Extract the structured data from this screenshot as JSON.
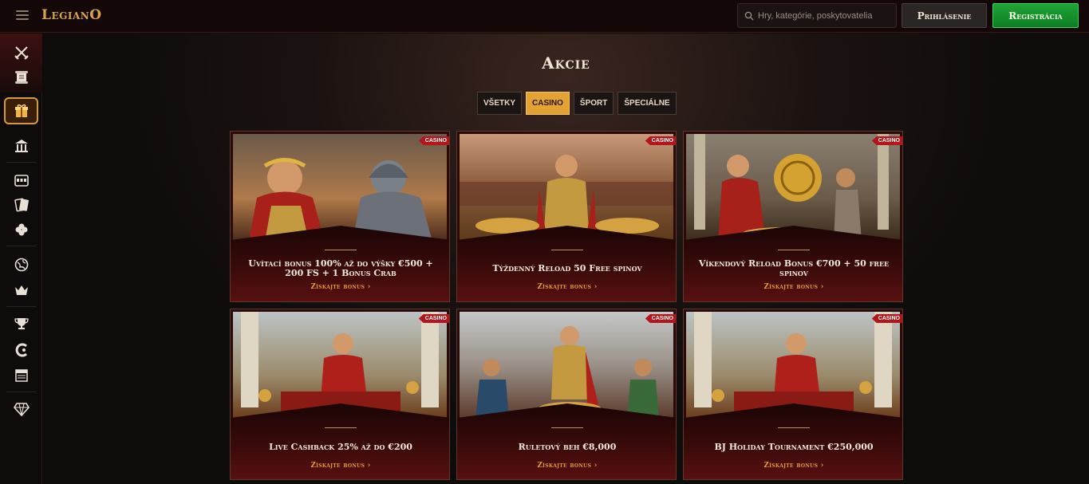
{
  "header": {
    "logo": "LegianO",
    "search_placeholder": "Hry, kategórie, poskytovatelia",
    "login_label": "Prihlásenie",
    "register_label": "Registrácia"
  },
  "sidebar": {
    "icons": [
      "crossed-swords-icon",
      "scroll-icon",
      "gift-chest-icon",
      "temple-icon",
      "slot-machine-icon",
      "cards-icon",
      "clover-icon",
      "globe-icon",
      "crown-icon",
      "trophy-icon",
      "rewards-icon",
      "news-icon",
      "diamond-icon"
    ]
  },
  "page": {
    "title": "Akcie"
  },
  "tabs": [
    {
      "label": "VŠETKY",
      "active": false
    },
    {
      "label": "CASINO",
      "active": true
    },
    {
      "label": "ŠPORT",
      "active": false
    },
    {
      "label": "ŠPECIÁLNE",
      "active": false
    }
  ],
  "promotions": [
    {
      "title": "Uvítací bonus 100% až do výšky €500 + 200 FS + 1 Bonus Crab",
      "cta": "Získajte bonus",
      "badge": "CASINO"
    },
    {
      "title": "Týždenný Reload 50 Free spinov",
      "cta": "Získajte bonus",
      "badge": "CASINO"
    },
    {
      "title": "Víkendový Reload Bonus €700 + 50 free spinov",
      "cta": "Získajte bonus",
      "badge": "CASINO"
    },
    {
      "title": "Live Cashback 25% až do €200",
      "cta": "Získajte bonus",
      "badge": "CASINO"
    },
    {
      "title": "Ruletový beh €8,000",
      "cta": "Získajte bonus",
      "badge": "CASINO"
    },
    {
      "title": "BJ Holiday Tournament €250,000",
      "cta": "Získajte bonus",
      "badge": "CASINO"
    }
  ],
  "colors": {
    "accent_gold": "#e3a234",
    "register_green": "#1fa436",
    "badge_red": "#b5141a",
    "cta_orange": "#e59a3a"
  }
}
